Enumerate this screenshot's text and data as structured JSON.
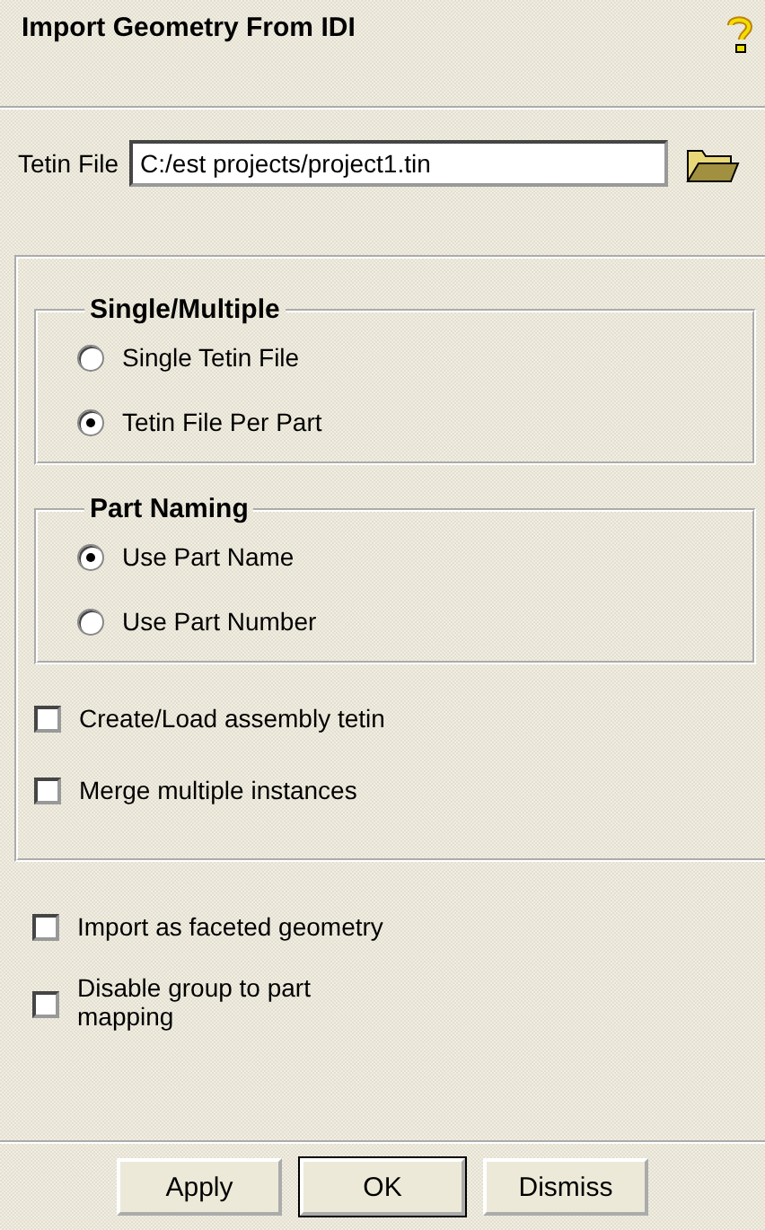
{
  "title": "Import Geometry From IDI",
  "tetin_file": {
    "label": "Tetin File",
    "value": "C:/est projects/project1.tin"
  },
  "groups": [
    {
      "title": "Single/Multiple",
      "options": [
        {
          "label": "Single Tetin File",
          "selected": false
        },
        {
          "label": "Tetin File Per Part",
          "selected": true
        }
      ]
    },
    {
      "title": "Part Naming",
      "options": [
        {
          "label": "Use Part Name",
          "selected": true
        },
        {
          "label": "Use Part Number",
          "selected": false
        }
      ]
    }
  ],
  "panel_checkboxes": [
    {
      "label": "Create/Load assembly tetin",
      "checked": false
    },
    {
      "label": "Merge multiple instances",
      "checked": false
    }
  ],
  "checkboxes": [
    {
      "label": "Import as faceted geometry",
      "checked": false
    },
    {
      "label": "Disable group to part mapping",
      "checked": false
    }
  ],
  "buttons": [
    {
      "label": "Apply",
      "default": false
    },
    {
      "label": "OK",
      "default": true
    },
    {
      "label": "Dismiss",
      "default": false
    }
  ]
}
